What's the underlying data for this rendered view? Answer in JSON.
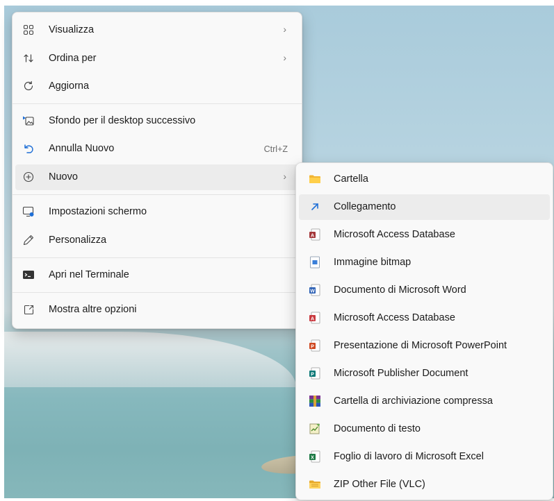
{
  "main_menu": {
    "items": [
      {
        "label": "Visualizza",
        "icon": "grid-icon",
        "chevron": "›"
      },
      {
        "label": "Ordina per",
        "icon": "sort-icon",
        "chevron": "›"
      },
      {
        "label": "Aggiorna",
        "icon": "refresh-icon"
      },
      {
        "label": "Sfondo per il desktop successivo",
        "icon": "next-wallpaper-icon"
      },
      {
        "label": "Annulla Nuovo",
        "icon": "undo-icon",
        "shortcut": "Ctrl+Z"
      },
      {
        "label": "Nuovo",
        "icon": "plus-circle-icon",
        "chevron": "›"
      },
      {
        "label": "Impostazioni schermo",
        "icon": "display-settings-icon"
      },
      {
        "label": "Personalizza",
        "icon": "pencil-icon"
      },
      {
        "label": "Apri nel Terminale",
        "icon": "terminal-icon"
      },
      {
        "label": "Mostra altre opzioni",
        "icon": "more-options-icon"
      }
    ]
  },
  "sub_menu": {
    "items": [
      {
        "label": "Cartella",
        "icon": "folder-icon"
      },
      {
        "label": "Collegamento",
        "icon": "shortcut-arrow-icon"
      },
      {
        "label": "Microsoft Access Database",
        "icon": "access-icon"
      },
      {
        "label": "Immagine bitmap",
        "icon": "bitmap-icon"
      },
      {
        "label": "Documento di Microsoft Word",
        "icon": "word-icon"
      },
      {
        "label": "Microsoft Access Database",
        "icon": "access-icon"
      },
      {
        "label": "Presentazione di Microsoft PowerPoint",
        "icon": "powerpoint-icon"
      },
      {
        "label": "Microsoft Publisher Document",
        "icon": "publisher-icon"
      },
      {
        "label": "Cartella di archiviazione compressa",
        "icon": "winrar-archive-icon"
      },
      {
        "label": "Documento di testo",
        "icon": "text-document-icon"
      },
      {
        "label": "Foglio di lavoro di Microsoft Excel",
        "icon": "excel-icon"
      },
      {
        "label": "ZIP Other File (VLC)",
        "icon": "zip-folder-icon"
      }
    ]
  },
  "colors": {
    "menu_bg": "#f9f9f9",
    "highlight": "#ececec",
    "accent_blue": "#1f6fd6"
  }
}
